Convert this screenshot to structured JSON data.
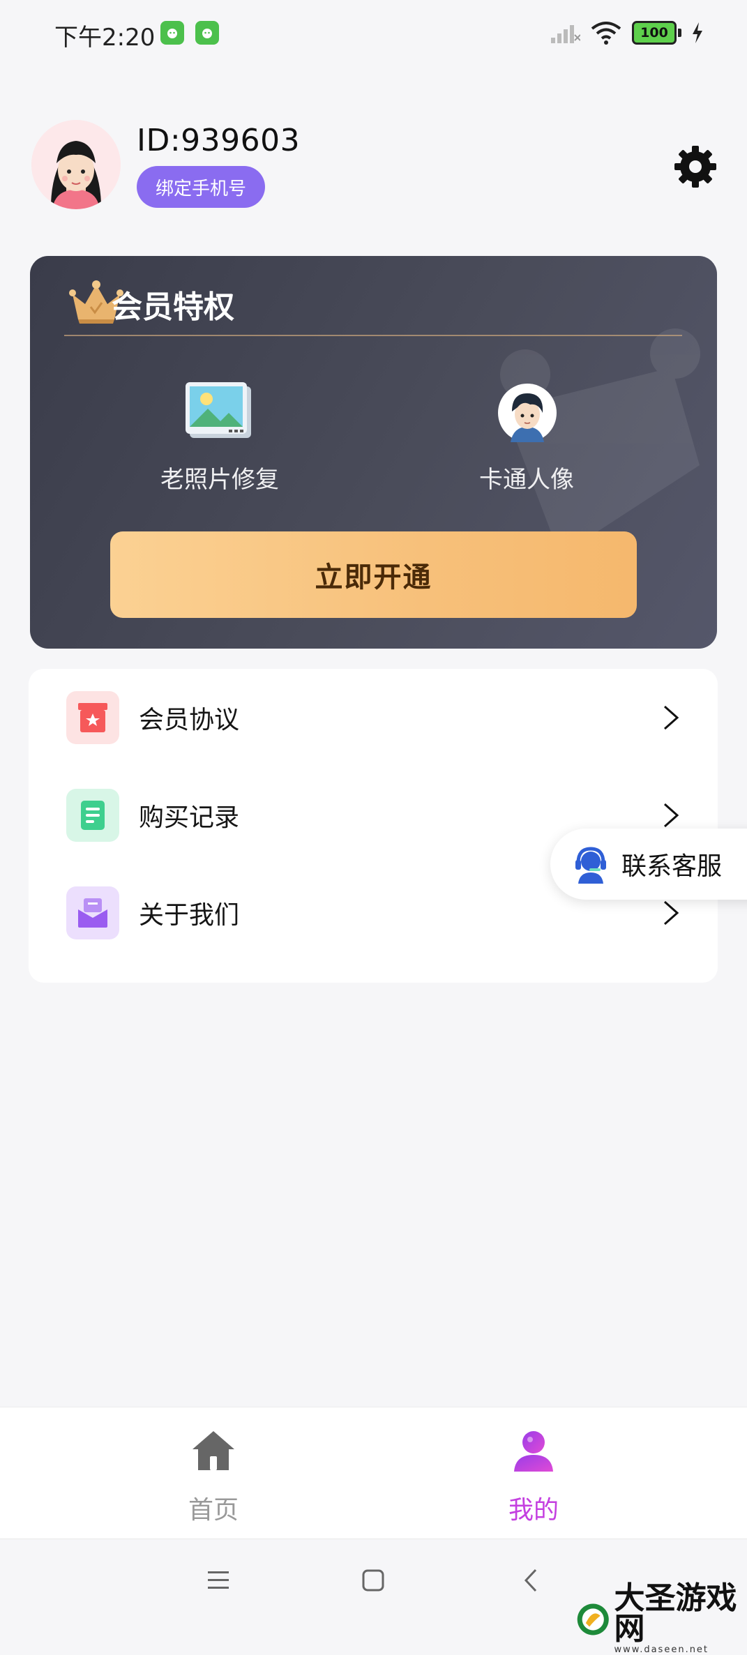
{
  "status_bar": {
    "time": "下午2:20",
    "battery": "100"
  },
  "profile": {
    "user_id": "ID:939603",
    "bind_phone_label": "绑定手机号"
  },
  "vip": {
    "title": "会员特权",
    "features": [
      {
        "label": "老照片修复",
        "icon": "photo-icon"
      },
      {
        "label": "卡通人像",
        "icon": "cartoon-avatar-icon"
      }
    ],
    "cta_label": "立即开通"
  },
  "menu": {
    "items": [
      {
        "label": "会员协议",
        "icon": "member-agreement-icon",
        "color": "#f6595a"
      },
      {
        "label": "购买记录",
        "icon": "purchase-record-icon",
        "color": "#3ecf8e"
      },
      {
        "label": "关于我们",
        "icon": "about-us-icon",
        "color": "#9a5cf0"
      }
    ]
  },
  "support": {
    "label": "联系客服"
  },
  "bottom_nav": {
    "tabs": [
      {
        "label": "首页",
        "icon": "home-icon",
        "active": false
      },
      {
        "label": "我的",
        "icon": "profile-icon",
        "active": true
      }
    ]
  },
  "watermark": {
    "brand": "大圣游戏网",
    "site": "www.daseen.net"
  },
  "colors": {
    "accent": "#c43fe0",
    "vip_bg": "#3f4150",
    "cta": "#f9c47f"
  }
}
